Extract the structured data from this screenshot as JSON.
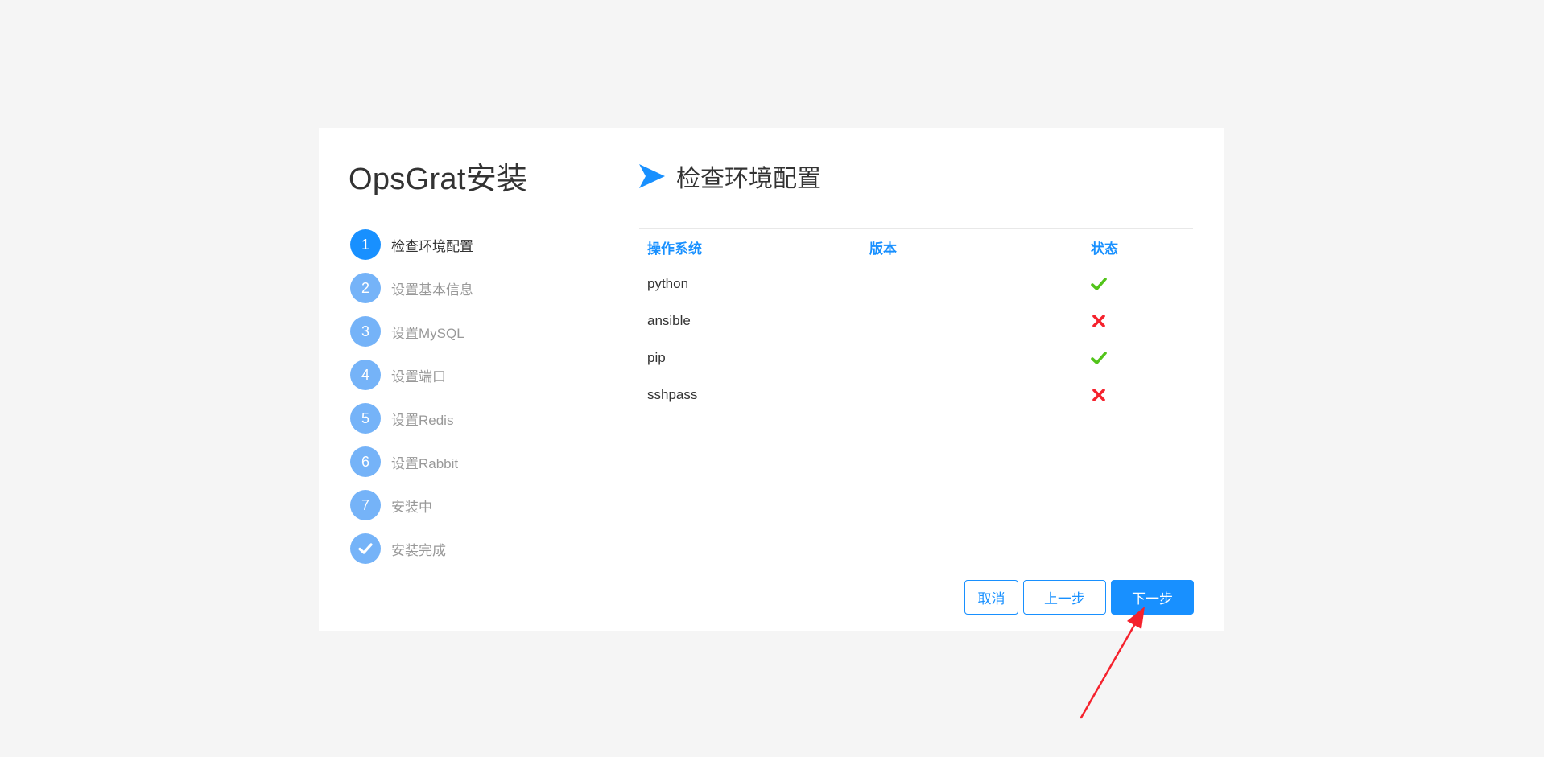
{
  "app_title": "OpsGrat安装",
  "steps": [
    {
      "number": "1",
      "label": "检查环境配置"
    },
    {
      "number": "2",
      "label": "设置基本信息"
    },
    {
      "number": "3",
      "label": "设置MySQL"
    },
    {
      "number": "4",
      "label": "设置端口"
    },
    {
      "number": "5",
      "label": "设置Redis"
    },
    {
      "number": "6",
      "label": "设置Rabbit"
    },
    {
      "number": "7",
      "label": "安装中"
    },
    {
      "number": "",
      "icon": "check-icon",
      "label": "安装完成"
    }
  ],
  "active_step": 1,
  "section": {
    "icon": "chevron-arrow-icon",
    "title": "检查环境配置"
  },
  "table": {
    "headers": {
      "os": "操作系统",
      "version": "版本",
      "status": "状态"
    },
    "rows": [
      {
        "name": "python",
        "version": "",
        "status": "ok"
      },
      {
        "name": "ansible",
        "version": "",
        "status": "fail"
      },
      {
        "name": "pip",
        "version": "",
        "status": "ok"
      },
      {
        "name": "sshpass",
        "version": "",
        "status": "fail"
      }
    ]
  },
  "buttons": {
    "cancel": "取消",
    "prev": "上一步",
    "next": "下一步"
  },
  "colors": {
    "primary": "#1890ff",
    "step_inactive": "#75b3f8",
    "ok": "#52c41a",
    "fail": "#f5222d",
    "annotation": "#f5222d"
  }
}
